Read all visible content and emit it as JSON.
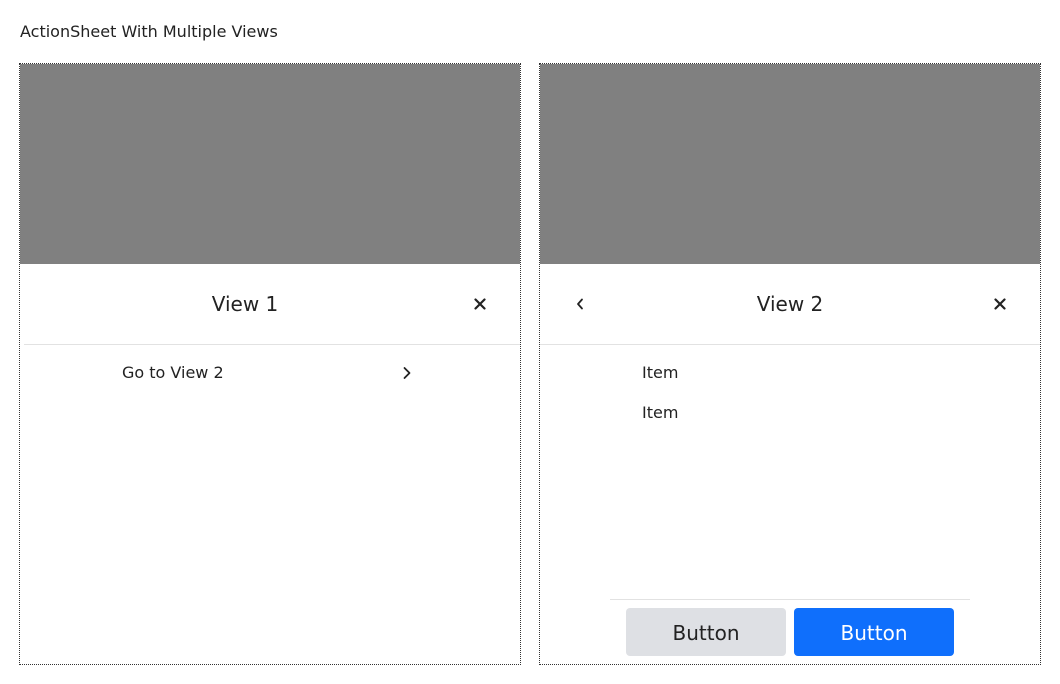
{
  "page": {
    "title": "ActionSheet With Multiple Views"
  },
  "colors": {
    "backdrop": "#808080",
    "primary": "#0f6ffc",
    "secondary": "#dee0e4"
  },
  "view1": {
    "title": "View 1",
    "close_icon": "close-icon",
    "menu_item_label": "Go to View 2",
    "menu_item_icon": "chevron-right-icon"
  },
  "view2": {
    "title": "View 2",
    "back_icon": "chevron-left-icon",
    "close_icon": "close-icon",
    "items": [
      "Item",
      "Item"
    ],
    "secondary_button": "Button",
    "primary_button": "Button"
  }
}
